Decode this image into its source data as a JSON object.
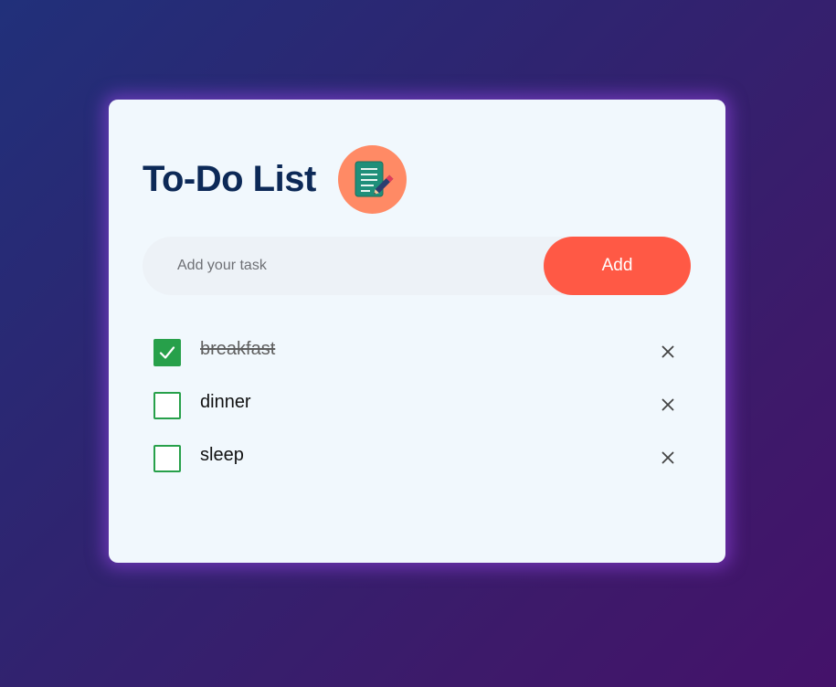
{
  "app": {
    "title": "To-Do List",
    "logo_icon": "notepad-pencil-icon"
  },
  "input": {
    "placeholder": "Add your task",
    "value": ""
  },
  "add_button": {
    "label": "Add"
  },
  "tasks": [
    {
      "text": "breakfast",
      "done": true
    },
    {
      "text": "dinner",
      "done": false
    },
    {
      "text": "sleep",
      "done": false
    }
  ],
  "icons": {
    "check": "check-icon",
    "delete": "close-icon"
  },
  "colors": {
    "accent": "#ff5945",
    "title": "#0c2957",
    "checkbox": "#27a04a",
    "logo_bg": "#ff8a65",
    "card_bg": "#f1f8fd"
  }
}
